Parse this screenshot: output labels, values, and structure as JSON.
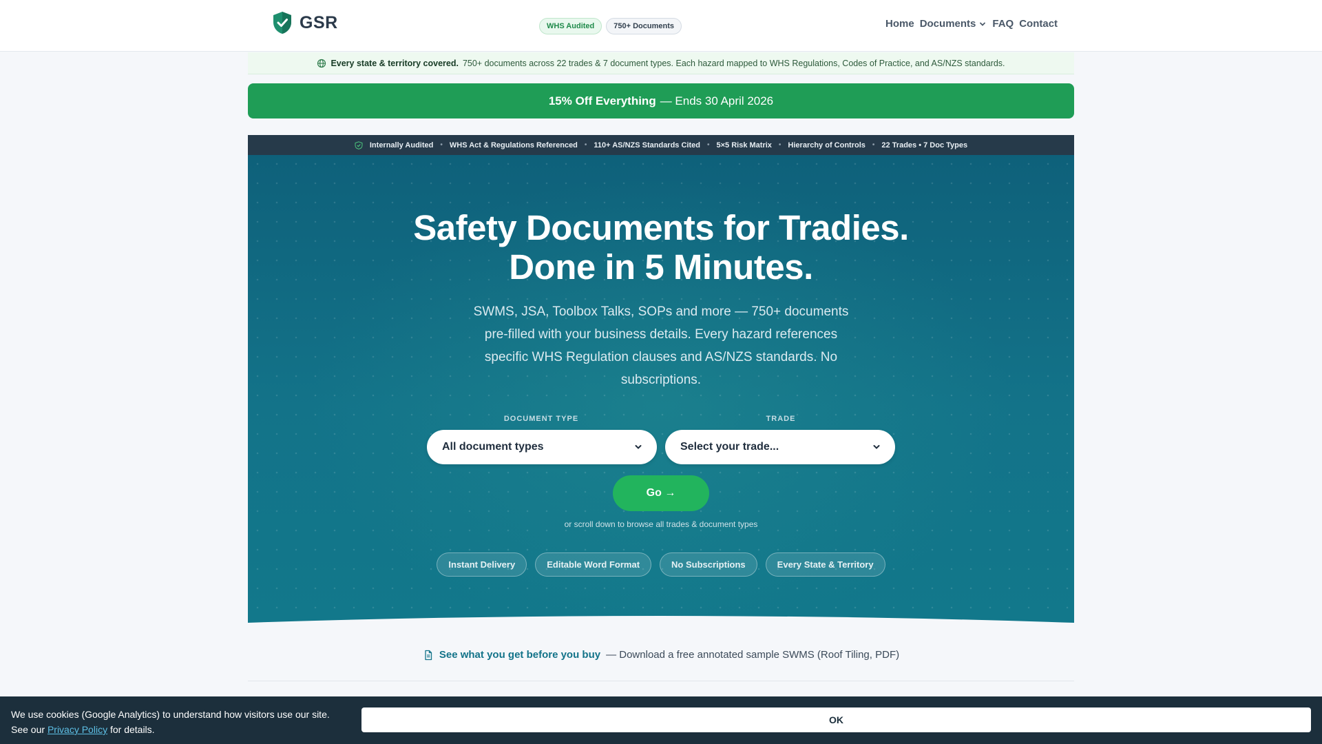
{
  "header": {
    "logo_text": "GSR",
    "badges": [
      "WHS Audited",
      "750+ Documents"
    ],
    "nav": [
      "Home",
      "Documents",
      "FAQ",
      "Contact"
    ]
  },
  "coverage": {
    "lead": "Every state & territory covered.",
    "text": "750+ documents across 22 trades & 7 document types. Each hazard mapped to WHS Regulations, Codes of Practice, and AS/NZS standards."
  },
  "promo": {
    "strong": "15% Off Everything",
    "rest": "— Ends 30 April 2026"
  },
  "trust_bar": [
    "Internally Audited",
    "WHS Act & Regulations Referenced",
    "110+ AS/NZS Standards Cited",
    "5×5 Risk Matrix",
    "Hierarchy of Controls",
    "22 Trades • 7 Doc Types"
  ],
  "hero": {
    "title_line1": "Safety Documents for Tradies.",
    "title_line2": "Done in 5 Minutes.",
    "subtitle": "SWMS, JSA, Toolbox Talks, SOPs and more — 750+ documents pre-filled with your business details. Every hazard references specific WHS Regulation clauses and AS/NZS standards. No subscriptions.",
    "doc_type_label": "DOCUMENT TYPE",
    "doc_type_value": "All document types",
    "trade_label": "TRADE",
    "trade_value": "Select your trade...",
    "go_label": "Go →",
    "scroll_hint": "or scroll down to browse all trades & document types",
    "pills": [
      "Instant Delivery",
      "Editable Word Format",
      "No Subscriptions",
      "Every State & Territory"
    ]
  },
  "sample": {
    "link": "See what you get before you buy",
    "rest": "— Download a free annotated sample SWMS (Roof Tiling, PDF)"
  },
  "cookie": {
    "line1": "We use cookies (Google Analytics) to understand how visitors use our site.",
    "see_our": "See our",
    "policy_link": "Privacy Policy",
    "for_details": "for details.",
    "ok": "OK"
  },
  "colors": {
    "brand_green": "#1f9d56",
    "hero_teal": "#137389",
    "dark_bar": "#263a4a"
  }
}
